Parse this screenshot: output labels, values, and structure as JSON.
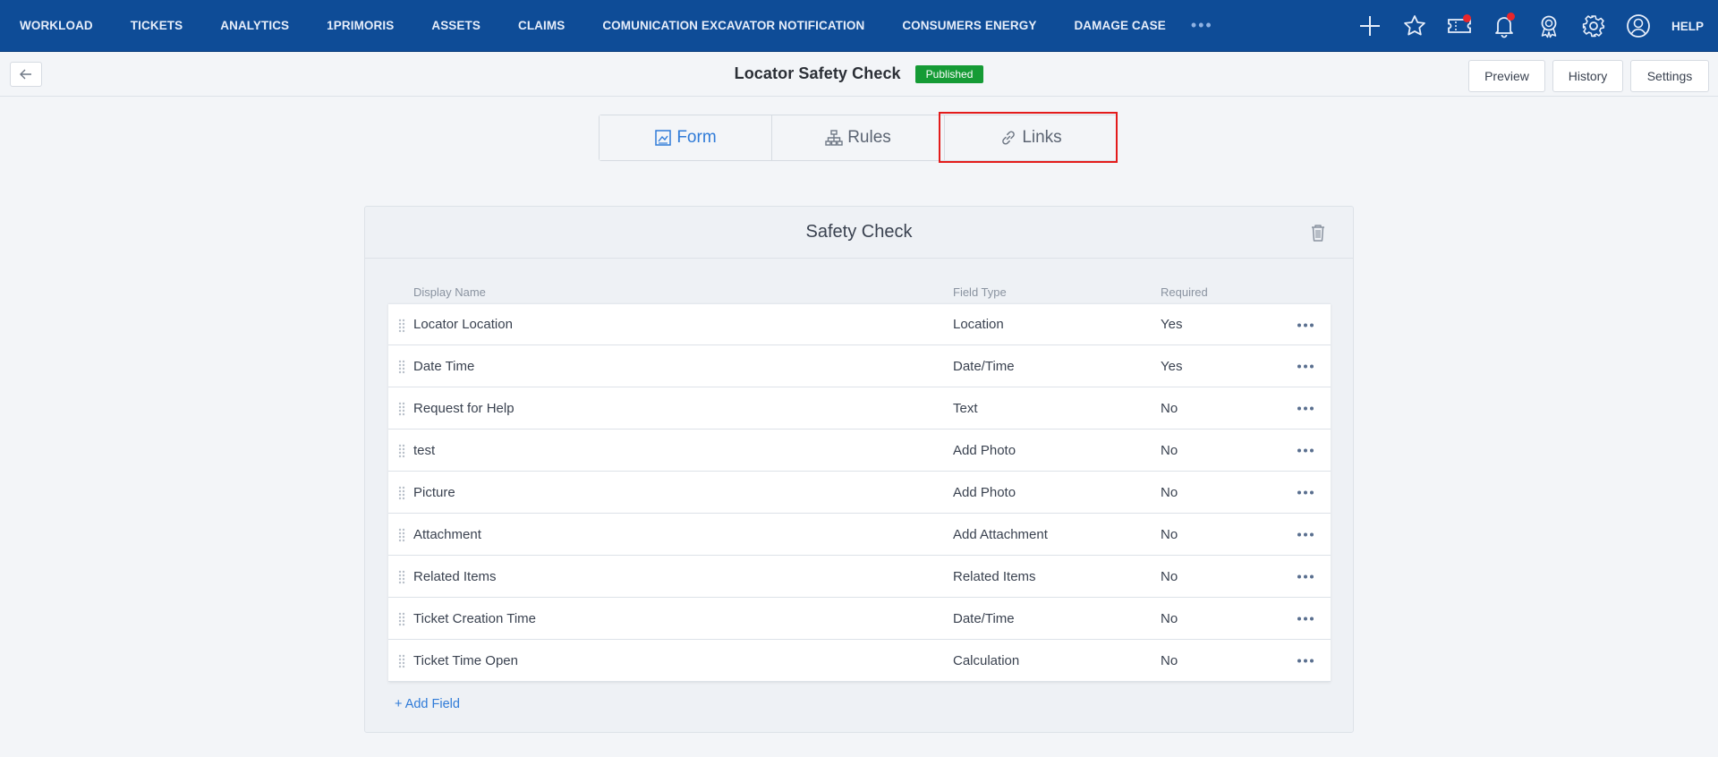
{
  "nav": {
    "items": [
      "WORKLOAD",
      "TICKETS",
      "ANALYTICS",
      "1PRIMORIS",
      "ASSETS",
      "CLAIMS",
      "COMUNICATION EXCAVATOR NOTIFICATION",
      "CONSUMERS ENERGY",
      "DAMAGE CASE"
    ],
    "more": "•••",
    "help": "HELP",
    "icons": [
      "plus-icon",
      "star-icon",
      "ticket-icon",
      "bell-icon",
      "award-icon",
      "gear-icon",
      "user-icon"
    ],
    "notification_color": "#e8262b"
  },
  "header": {
    "title": "Locator Safety Check",
    "status": "Published",
    "status_color": "#159b35",
    "buttons": {
      "preview": "Preview",
      "history": "History",
      "settings": "Settings"
    }
  },
  "tabs": [
    {
      "label": "Form",
      "icon": "form-icon",
      "active": true
    },
    {
      "label": "Rules",
      "icon": "sitemap-icon",
      "active": false
    },
    {
      "label": "Links",
      "icon": "link-icon",
      "active": false
    }
  ],
  "section": {
    "title": "Safety Check",
    "columns": {
      "name": "Display Name",
      "type": "Field Type",
      "required": "Required"
    },
    "fields": [
      {
        "name": "Locator Location",
        "type": "Location",
        "required": "Yes"
      },
      {
        "name": "Date Time",
        "type": "Date/Time",
        "required": "Yes"
      },
      {
        "name": "Request for Help",
        "type": "Text",
        "required": "No"
      },
      {
        "name": "test",
        "type": "Add Photo",
        "required": "No"
      },
      {
        "name": "Picture",
        "type": "Add Photo",
        "required": "No"
      },
      {
        "name": "Attachment",
        "type": "Add Attachment",
        "required": "No"
      },
      {
        "name": "Related Items",
        "type": "Related Items",
        "required": "No"
      },
      {
        "name": "Ticket Creation Time",
        "type": "Date/Time",
        "required": "No"
      },
      {
        "name": "Ticket Time Open",
        "type": "Calculation",
        "required": "No"
      }
    ],
    "add_field": "+ Add Field"
  },
  "colors": {
    "nav_bg": "#0e4c97",
    "accent": "#2f7bd8",
    "highlight": "#e31b1b"
  }
}
